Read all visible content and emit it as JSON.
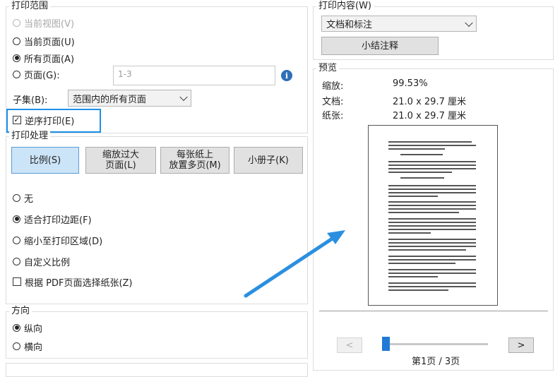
{
  "print_range": {
    "legend": "打印范围",
    "options": [
      {
        "label": "当前视图(V)",
        "checked": false,
        "disabled": true
      },
      {
        "label": "当前页面(U)",
        "checked": false,
        "disabled": false
      },
      {
        "label": "所有页面(A)",
        "checked": true,
        "disabled": false
      },
      {
        "label": "页面(G):",
        "checked": false,
        "disabled": false
      }
    ],
    "pages_value": "1-3",
    "info_icon": "info-icon",
    "subset_label": "子集(B):",
    "subset_value": "范围内的所有页面",
    "reverse_label": "逆序打印(E)",
    "reverse_checked": true
  },
  "print_handling": {
    "legend": "打印处理",
    "buttons": [
      {
        "label": "比例(S)",
        "active": true
      },
      {
        "label": "缩放过大页面(L)",
        "line1": "缩放过大",
        "line2": "页面(L)",
        "active": false
      },
      {
        "label": "每张纸上放置多页(M)",
        "line1": "每张纸上",
        "line2": "放置多页(M)",
        "active": false
      },
      {
        "label": "小册子(K)",
        "active": false
      }
    ],
    "scale_options": [
      {
        "label": "无",
        "checked": false
      },
      {
        "label": "适合打印边距(F)",
        "checked": true
      },
      {
        "label": "缩小至打印区域(D)",
        "checked": false
      },
      {
        "label": "自定义比例",
        "checked": false
      }
    ],
    "paper_by_pdf_label": "根据 PDF页面选择纸张(Z)",
    "paper_by_pdf_checked": false
  },
  "orientation": {
    "legend": "方向",
    "options": [
      {
        "label": "纵向",
        "checked": true
      },
      {
        "label": "横向",
        "checked": false
      }
    ]
  },
  "print_content": {
    "legend": "打印内容(W)",
    "select_value": "文档和标注",
    "summarize_button": "小结注释"
  },
  "preview": {
    "legend": "预览",
    "zoom_label": "缩放:",
    "zoom_value": "99.53%",
    "document_label": "文档:",
    "document_value": "21.0 x 29.7 厘米",
    "paper_label": "纸张:",
    "paper_value": "21.0 x 29.7 厘米",
    "prev_label": "<",
    "next_label": ">",
    "page_indicator": "第1页 / 3页",
    "current_page": 1,
    "total_pages": 3
  },
  "colors": {
    "highlight": "#1e90e8",
    "arrow": "#2b8fe0",
    "slider": "#1f7ad6"
  }
}
